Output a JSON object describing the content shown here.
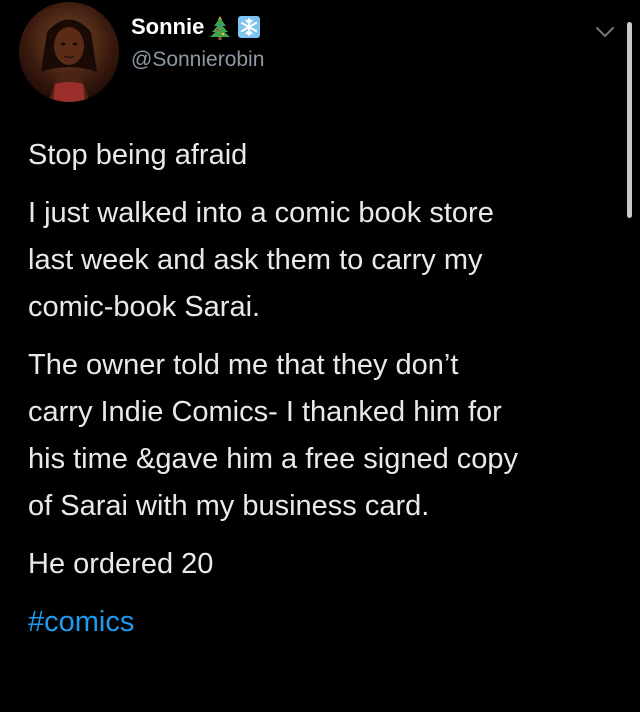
{
  "user": {
    "display_name": "Sonnie",
    "name_emojis": [
      "christmas-tree-icon",
      "snowflake-icon"
    ],
    "handle": "@Sonnierobin"
  },
  "tweet": {
    "paragraphs": [
      [
        "Stop being afraid"
      ],
      [
        "I just walked into a comic book store",
        "last week and ask them to carry my",
        "comic-book Sarai."
      ],
      [
        "The owner told me that they don’t",
        "carry Indie Comics- I thanked him for",
        "his time &gave him a free signed copy",
        "of Sarai with my business card."
      ],
      [
        "He ordered 20"
      ]
    ],
    "hashtag": "#comics"
  },
  "colors": {
    "background": "#000000",
    "text": "#e7e9ea",
    "secondary": "#8b98a5",
    "link": "#1d9bf0"
  }
}
